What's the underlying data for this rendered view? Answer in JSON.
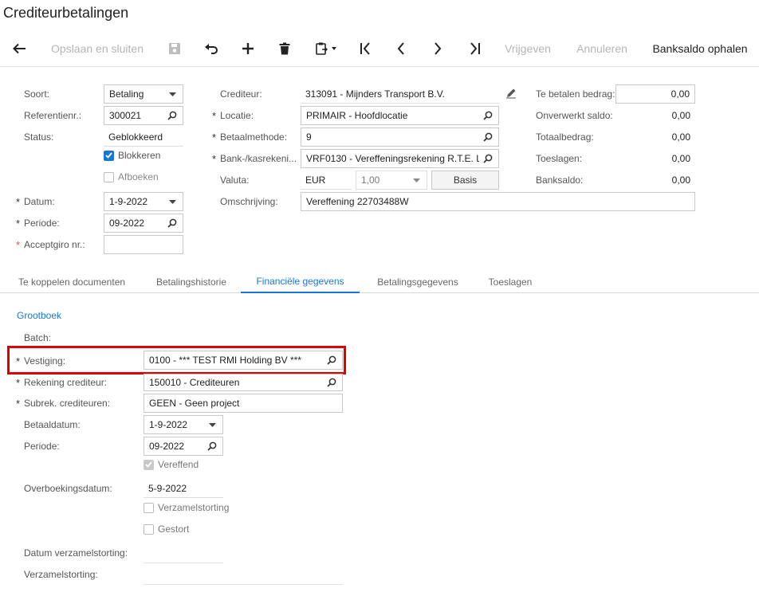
{
  "header": {
    "title": "Crediteurbetalingen"
  },
  "toolbar": {
    "save_close": "Opslaan en sluiten",
    "release": "Vrijgeven",
    "cancel": "Annuleren",
    "bank_balance": "Banksaldo ophalen"
  },
  "form": {
    "soort_label": "Soort:",
    "soort_value": "Betaling",
    "ref_label": "Referentienr.:",
    "ref_value": "300021",
    "status_label": "Status:",
    "status_value": "Geblokkeerd",
    "blokkeren_label": "Blokkeren",
    "blokkeren_checked": true,
    "afboeken_label": "Afboeken",
    "afboeken_checked": false,
    "datum_label": "Datum:",
    "datum_value": "1-9-2022",
    "periode_label": "Periode:",
    "periode_value": "09-2022",
    "acceptgiro_label": "Acceptgiro nr.:",
    "acceptgiro_value": "",
    "crediteur_label": "Crediteur:",
    "crediteur_value": "313091 - Mijnders Transport B.V.",
    "locatie_label": "Locatie:",
    "locatie_value": "PRIMAIR - Hoofdlocatie",
    "betaalmethode_label": "Betaalmethode:",
    "betaalmethode_value": "9",
    "bank_label": "Bank-/kasrekeni...",
    "bank_value": "VRF0130 - Vereffeningsrekening R.T.E. L",
    "valuta_label": "Valuta:",
    "valuta_value": "EUR",
    "rate_value": "1,00",
    "basis_label": "Basis",
    "omschrijving_label": "Omschrijving:",
    "omschrijving_value": "Vereffening 22703488W",
    "te_betalen_label": "Te betalen bedrag:",
    "te_betalen_value": "0,00",
    "onverwerkt_label": "Onverwerkt saldo:",
    "onverwerkt_value": "0,00",
    "totaal_label": "Totaalbedrag:",
    "totaal_value": "0,00",
    "toeslagen_label": "Toeslagen:",
    "toeslagen_value": "0,00",
    "banksaldo_label": "Banksaldo:",
    "banksaldo_value": "0,00"
  },
  "tabs": [
    {
      "label": "Te koppelen documenten"
    },
    {
      "label": "Betalingshistorie"
    },
    {
      "label": "Financiële gegevens"
    },
    {
      "label": "Betalingsgegevens"
    },
    {
      "label": "Toeslagen"
    }
  ],
  "active_tab": 2,
  "gl": {
    "section_title": "Grootboek",
    "batch_label": "Batch:",
    "vestiging_label": "Vestiging:",
    "vestiging_value": "0100 - *** TEST RMI Holding BV ***",
    "rekening_label": "Rekening crediteur:",
    "rekening_value": "150010 - Crediteuren",
    "subrek_label": "Subrek. crediteuren:",
    "subrek_value": "GEEN - Geen project",
    "betaaldatum_label": "Betaaldatum:",
    "betaaldatum_value": "1-9-2022",
    "periode_label": "Periode:",
    "periode_value": "09-2022",
    "vereffend_label": "Vereffend",
    "vereffend_checked": true,
    "overboeking_label": "Overboekingsdatum:",
    "overboeking_value": "5-9-2022",
    "verzamelstorting_chk_label": "Verzamelstorting",
    "verzamelstorting_checked": false,
    "gestort_label": "Gestort",
    "gestort_checked": false,
    "datum_verzamel_label": "Datum verzamelstorting:",
    "verzamel_label": "Verzamelstorting:"
  },
  "colors": {
    "accent": "#1976d2",
    "highlight": "#e00000"
  }
}
